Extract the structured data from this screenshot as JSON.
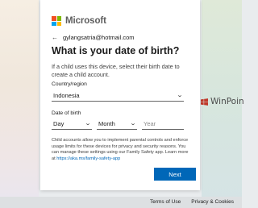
{
  "header": {
    "brand": "Microsoft"
  },
  "account": {
    "email": "gylangsatria@hotmail.com"
  },
  "page": {
    "title": "What is your date of birth?",
    "description": "If a child uses this device, select their birth date to create a child account."
  },
  "country": {
    "label": "Country/region",
    "value": "Indonesia"
  },
  "birthdate": {
    "label": "Date of birth",
    "day": "Day",
    "month": "Month",
    "year_placeholder": "Year"
  },
  "notice": {
    "text": "Child accounts allow you to implement parental controls and enforce usage limits for these devices for privacy and security reasons. You can manage these settings using our Family Safety app. Learn more at",
    "link": "https://aka.ms/family-safety-app"
  },
  "buttons": {
    "next": "Next"
  },
  "footer": {
    "terms": "Terms of Use",
    "privacy": "Privacy & Cookies"
  },
  "watermark": {
    "text": "WinPoin"
  },
  "colors": {
    "accent": "#0067b8",
    "link": "#0067b8"
  },
  "icons": {
    "back": "back-arrow-icon",
    "chevron": "chevron-down-icon",
    "brand_logo": "microsoft-logo-icon",
    "watermark_logo": "windows-logo-icon"
  }
}
